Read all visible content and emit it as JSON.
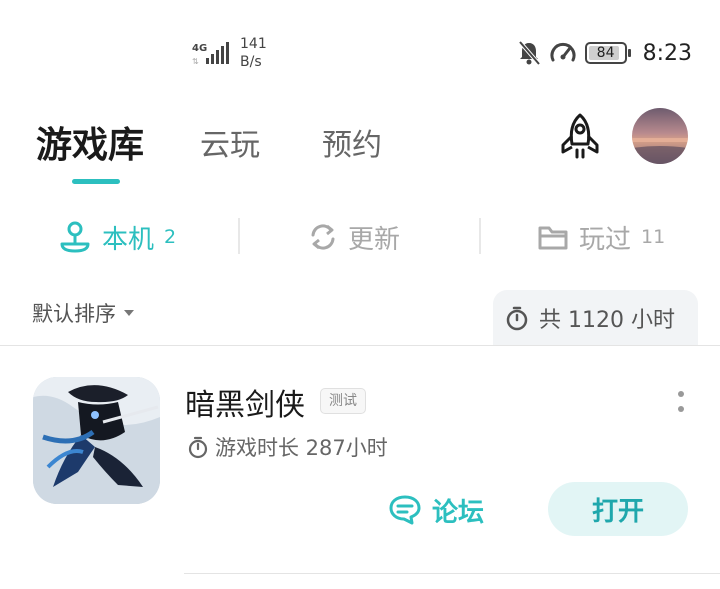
{
  "status_bar": {
    "network_type": "4G",
    "net_speed_value": "141",
    "net_speed_unit": "B/s",
    "battery_level": "84",
    "time": "8:23"
  },
  "top_tabs": [
    {
      "label": "游戏库",
      "active": true
    },
    {
      "label": "云玩",
      "active": false
    },
    {
      "label": "预约",
      "active": false
    }
  ],
  "sub_tabs": [
    {
      "label": "本机",
      "count": "2",
      "icon": "joystick-icon",
      "active": true
    },
    {
      "label": "更新",
      "count": "",
      "icon": "refresh-icon",
      "active": false
    },
    {
      "label": "玩过",
      "count": "11",
      "icon": "folder-icon",
      "active": false
    }
  ],
  "sort": {
    "label": "默认排序"
  },
  "total_time": {
    "label": "共 1120 小时"
  },
  "games": [
    {
      "title": "暗黑剑侠",
      "badge": "测试",
      "playtime": "游戏时长 287小时",
      "forum_label": "论坛",
      "open_label": "打开"
    }
  ],
  "colors": {
    "accent": "#2cbfbf",
    "open_button_bg": "#e2f5f5",
    "inactive_text": "#a8a8a8"
  }
}
